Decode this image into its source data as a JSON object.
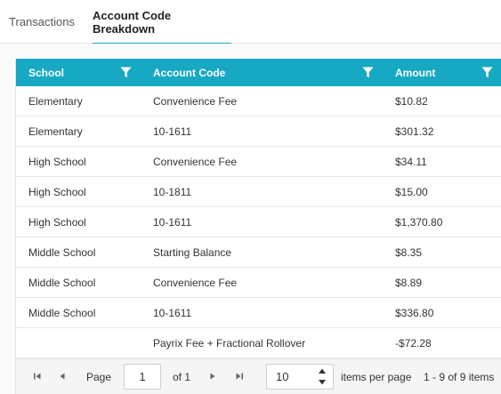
{
  "tabs": [
    {
      "label": "Transactions",
      "active": false
    },
    {
      "label": "Account Code Breakdown",
      "active": true
    }
  ],
  "grid": {
    "columns": [
      {
        "label": "School",
        "icon": "filter-icon"
      },
      {
        "label": "Account Code",
        "icon": "filter-icon"
      },
      {
        "label": "Amount",
        "icon": "filter-icon"
      }
    ],
    "rows": [
      {
        "school": "Elementary",
        "code": "Convenience Fee",
        "amount": "$10.82"
      },
      {
        "school": "Elementary",
        "code": "10-1611",
        "amount": "$301.32"
      },
      {
        "school": "High School",
        "code": "Convenience Fee",
        "amount": "$34.11"
      },
      {
        "school": "High School",
        "code": "10-1811",
        "amount": "$15.00"
      },
      {
        "school": "High School",
        "code": "10-1611",
        "amount": "$1,370.80"
      },
      {
        "school": "Middle School",
        "code": "Starting Balance",
        "amount": "$8.35"
      },
      {
        "school": "Middle School",
        "code": "Convenience Fee",
        "amount": "$8.89"
      },
      {
        "school": "Middle School",
        "code": "10-1611",
        "amount": "$336.80"
      },
      {
        "school": "",
        "code": "Payrix Fee + Fractional Rollover",
        "amount": "-$72.28"
      }
    ]
  },
  "pager": {
    "page_label": "Page",
    "page_value": "1",
    "of_label": "of 1",
    "page_size": "10",
    "items_per_page_label": "items per page",
    "range_label": "1 - 9 of 9 items",
    "icons": [
      "first-page-icon",
      "previous-page-icon",
      "next-page-icon",
      "last-page-icon"
    ]
  },
  "colors": {
    "accent": "#17a8c4",
    "header_text": "#ffffff",
    "pager_bg": "#f5f5f5"
  }
}
